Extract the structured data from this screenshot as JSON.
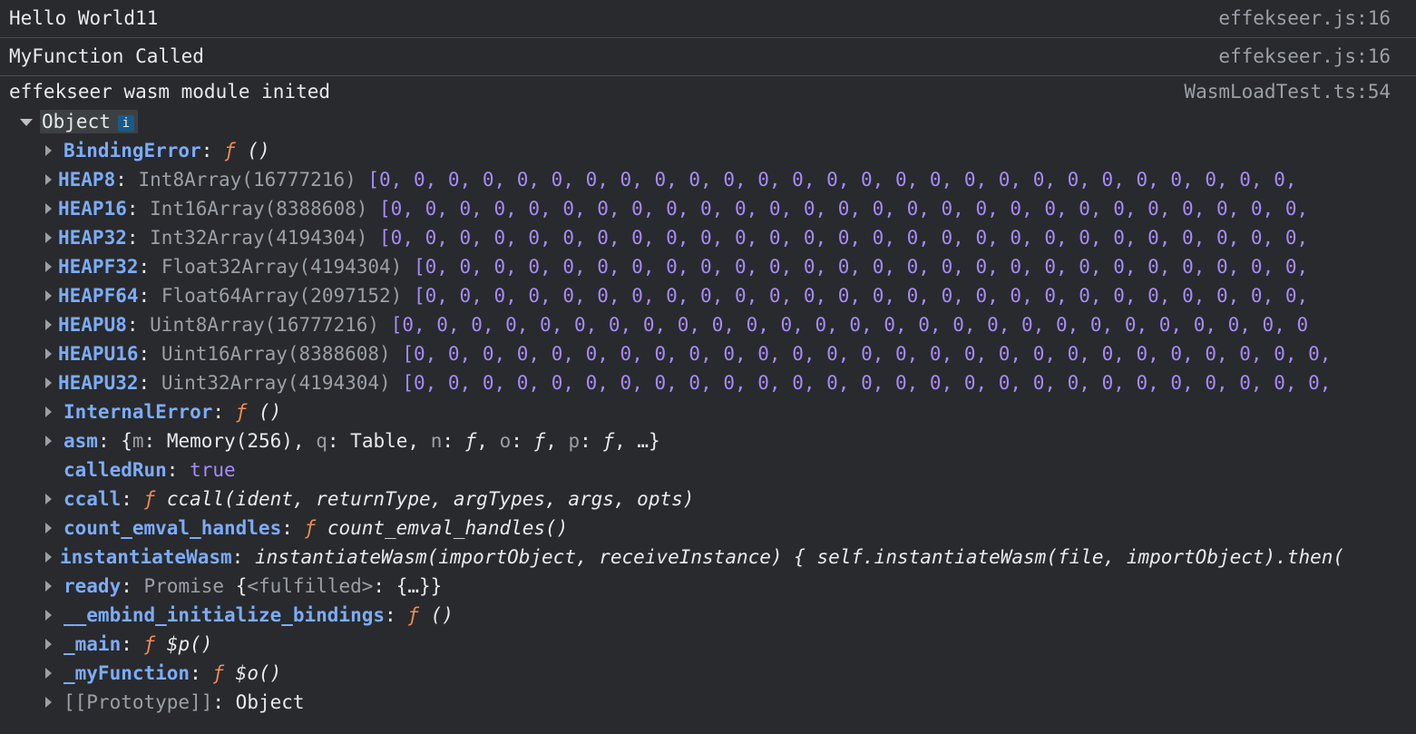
{
  "messages": [
    {
      "text": "Hello World11",
      "source": "effekseer.js:16"
    },
    {
      "text": "MyFunction Called",
      "source": "effekseer.js:16"
    },
    {
      "text": "effekseer wasm module inited",
      "source": "WasmLoadTest.ts:54"
    }
  ],
  "object": {
    "label": "Object",
    "info": "i"
  },
  "props": {
    "binding_error": {
      "key": "BindingError",
      "f": "ƒ",
      "sig": " ()"
    },
    "heap8": {
      "key": "HEAP8",
      "type": "Int8Array(16777216)",
      "values": "[0, 0, 0, 0, 0, 0, 0, 0, 0, 0, 0, 0, 0, 0, 0, 0, 0, 0, 0, 0, 0, 0, 0, 0, 0, 0, 0,"
    },
    "heap16": {
      "key": "HEAP16",
      "type": "Int16Array(8388608)",
      "values": "[0, 0, 0, 0, 0, 0, 0, 0, 0, 0, 0, 0, 0, 0, 0, 0, 0, 0, 0, 0, 0, 0, 0, 0, 0, 0, 0,"
    },
    "heap32": {
      "key": "HEAP32",
      "type": "Int32Array(4194304)",
      "values": "[0, 0, 0, 0, 0, 0, 0, 0, 0, 0, 0, 0, 0, 0, 0, 0, 0, 0, 0, 0, 0, 0, 0, 0, 0, 0, 0,"
    },
    "heapf32": {
      "key": "HEAPF32",
      "type": "Float32Array(4194304)",
      "values": "[0, 0, 0, 0, 0, 0, 0, 0, 0, 0, 0, 0, 0, 0, 0, 0, 0, 0, 0, 0, 0, 0, 0, 0, 0, 0,"
    },
    "heapf64": {
      "key": "HEAPF64",
      "type": "Float64Array(2097152)",
      "values": "[0, 0, 0, 0, 0, 0, 0, 0, 0, 0, 0, 0, 0, 0, 0, 0, 0, 0, 0, 0, 0, 0, 0, 0, 0, 0,"
    },
    "heapu8": {
      "key": "HEAPU8",
      "type": "Uint8Array(16777216)",
      "values": "[0, 0, 0, 0, 0, 0, 0, 0, 0, 0, 0, 0, 0, 0, 0, 0, 0, 0, 0, 0, 0, 0, 0, 0, 0, 0, 0"
    },
    "heapu16": {
      "key": "HEAPU16",
      "type": "Uint16Array(8388608)",
      "values": "[0, 0, 0, 0, 0, 0, 0, 0, 0, 0, 0, 0, 0, 0, 0, 0, 0, 0, 0, 0, 0, 0, 0, 0, 0, 0, 0,"
    },
    "heapu32": {
      "key": "HEAPU32",
      "type": "Uint32Array(4194304)",
      "values": "[0, 0, 0, 0, 0, 0, 0, 0, 0, 0, 0, 0, 0, 0, 0, 0, 0, 0, 0, 0, 0, 0, 0, 0, 0, 0, 0,"
    },
    "internal_error": {
      "key": "InternalError",
      "f": "ƒ",
      "sig": " ()"
    },
    "asm": {
      "key": "asm",
      "value_open": "{",
      "m_key": "m",
      "m_val": "Memory(256)",
      "q_key": "q",
      "q_val": "Table",
      "n_key": "n",
      "o_key": "o",
      "p_key": "p",
      "f": "ƒ",
      "tail": "…}"
    },
    "called_run": {
      "key": "calledRun",
      "value": "true"
    },
    "ccall": {
      "key": "ccall",
      "f": "ƒ",
      "sig": " ccall(ident, returnType, argTypes, args, opts)"
    },
    "count_emval": {
      "key": "count_emval_handles",
      "f": "ƒ",
      "sig": " count_emval_handles()"
    },
    "instantiate_wasm": {
      "key": "instantiateWasm",
      "sig": "instantiateWasm(importObject, receiveInstance) { self.instantiateWasm(file, importObject).then("
    },
    "ready": {
      "key": "ready",
      "cls": "Promise",
      "open": "{",
      "state": "<fulfilled>",
      "rest": ": {…}}"
    },
    "embind_init": {
      "key": "__embind_initialize_bindings",
      "f": "ƒ",
      "sig": " ()"
    },
    "main": {
      "key": "_main",
      "f": "ƒ",
      "sig": " $p()"
    },
    "my_function": {
      "key": "_myFunction",
      "f": "ƒ",
      "sig": " $o()"
    },
    "prototype": {
      "key": "[[Prototype]]",
      "value": "Object"
    }
  },
  "colors": {
    "background": "#292a2d",
    "key": "#7cacf8",
    "function_f": "#f28b54",
    "number": "#a78bfa",
    "dim": "#9aa0a6"
  }
}
